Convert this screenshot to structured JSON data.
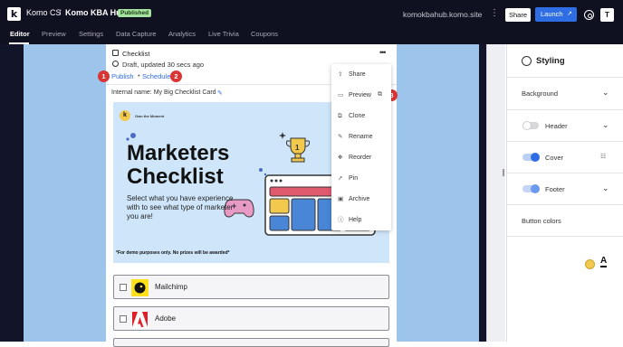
{
  "topbar": {
    "logo_letter": "k",
    "workspace": "Komo CS",
    "separator": "/",
    "hub": "Komo KBA Hub",
    "status": "Published",
    "domain": "komokbahub.komo.site",
    "share_label": "Share",
    "launch_label": "Launch",
    "avatar_initial": "T",
    "kebab": "⋮"
  },
  "tabs": [
    {
      "label": "Editor",
      "active": true
    },
    {
      "label": "Preview"
    },
    {
      "label": "Settings"
    },
    {
      "label": "Data Capture"
    },
    {
      "label": "Analytics"
    },
    {
      "label": "Live Trivia"
    },
    {
      "label": "Coupons"
    }
  ],
  "card": {
    "title": "Checklist",
    "status_text": "Draft, updated 30 secs ago",
    "publish_link": "Publish",
    "separator": "•",
    "schedule_link": "Schedule",
    "internal_name": "Internal name: My Big Checklist Card",
    "hero": {
      "brand_small": "Own the Moment",
      "logo_letter": "k",
      "heading_line1": "Marketers",
      "heading_line2": "Checklist",
      "subtitle": "Select what you have experience with to see what type of marketer you are!",
      "disclaimer": "*For demo purposes only. No prizes will be awarded*"
    },
    "options": [
      {
        "label": "Mailchimp"
      },
      {
        "label": "Adobe"
      }
    ]
  },
  "context_menu": {
    "items": [
      {
        "label": "Share",
        "icon": "share-icon"
      },
      {
        "label": "Preview",
        "icon": "monitor-icon"
      },
      {
        "label": "Clone",
        "icon": "clone-icon"
      },
      {
        "label": "Rename",
        "icon": "rename-icon"
      },
      {
        "label": "Reorder",
        "icon": "move-icon"
      },
      {
        "label": "Pin",
        "icon": "pin-icon"
      },
      {
        "label": "Archive",
        "icon": "archive-icon"
      },
      {
        "label": "Help",
        "icon": "help-icon"
      }
    ]
  },
  "badges": [
    "1",
    "2",
    "3"
  ],
  "styling": {
    "title": "Styling",
    "rows": [
      {
        "label": "Background"
      },
      {
        "label": "Header",
        "toggle": "off"
      },
      {
        "label": "Cover",
        "toggle": "on"
      },
      {
        "label": "Footer",
        "toggle": "on"
      },
      {
        "label": "Button colors"
      }
    ],
    "button_color": "#f2c94c",
    "text_color_glyph": "A"
  },
  "colors": {
    "accent": "#2e6de3",
    "badge": "#d93535",
    "canvas": "#9dc4ea"
  }
}
